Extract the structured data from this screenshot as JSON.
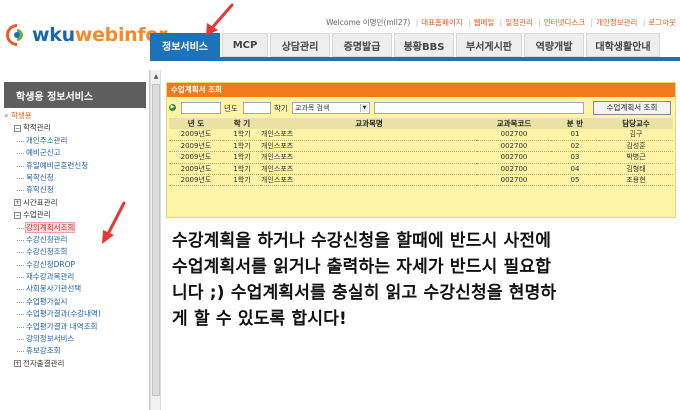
{
  "header": {
    "logo_part1": "wku",
    "logo_part2": "webinfor.",
    "welcome": "Welcome 이명민(mll27)",
    "util_links": [
      "대표홈페이지",
      "웹메일",
      "일정관리",
      "인터넷디스크",
      "개인정보관리",
      "로그아웃"
    ],
    "gnb_tabs": [
      "정보서비스",
      "MCP",
      "상담관리",
      "증명발급",
      "봉황BBS",
      "부서게시판",
      "역량개발",
      "대학생활안내"
    ],
    "active_tab_index": 0
  },
  "sidebar": {
    "title": "학생용 정보서비스",
    "root": "» 학생용",
    "groups": [
      {
        "label": "학적관리",
        "expanded": true,
        "items": [
          "개인주소관리",
          "예비군신고",
          "휴일예비군훈련신청",
          "복학신청",
          "휴학신청"
        ]
      },
      {
        "label": "시간표관리",
        "expanded": false,
        "items": []
      },
      {
        "label": "수업관리",
        "expanded": true,
        "items": [
          "강의계획서조회",
          "수강신청관리",
          "수강신청조회",
          "수강신청DROP",
          "재수강과목관리",
          "사회봉사기관선택",
          "수업평가실시",
          "수업평가결과(수강내역)",
          "수업평가결과 내역조회",
          "강의정보서비스",
          "휴보강조회"
        ]
      },
      {
        "label": "전자출결관리",
        "expanded": false,
        "items": []
      }
    ],
    "highlighted_item": "강의계획서조회"
  },
  "panel": {
    "title": "수업계획서 조회",
    "year_label": "년도",
    "term_label": "학기",
    "search_type": "교과목 검색",
    "button_label": "수업계획서 조회",
    "columns": [
      "년 도",
      "학 기",
      "교과목명",
      "교과목코드",
      "분 반",
      "담당교수"
    ],
    "rows": [
      [
        "2009년도",
        "1학기",
        "개인스포츠",
        "002700",
        "01",
        "김구"
      ],
      [
        "2009년도",
        "1학기",
        "개인스포츠",
        "002700",
        "02",
        "김성훈"
      ],
      [
        "2009년도",
        "1학기",
        "개인스포츠",
        "002700",
        "03",
        "박병근"
      ],
      [
        "2009년도",
        "1학기",
        "개인스포츠",
        "002700",
        "04",
        "김형태"
      ],
      [
        "2009년도",
        "1학기",
        "개인스포츠",
        "002700",
        "05",
        "조용현"
      ]
    ]
  },
  "caption": {
    "lines": [
      "수강계획을 하거나 수강신청을 할때에 반드시 사전에",
      "수업계획서를 읽거나 출력하는 자세가 반드시 필요합",
      "니다 ;) 수업계획서를 충실히 읽고 수강신청을 현명하",
      "게 할 수 있도록 합시다!"
    ]
  },
  "colors": {
    "brand_blue": "#1e73b8",
    "brand_orange": "#f08c2a",
    "panel_title_bg": "#f07a1c",
    "panel_bg": "#fff3a8",
    "annotation_arrow": "#e53935"
  }
}
